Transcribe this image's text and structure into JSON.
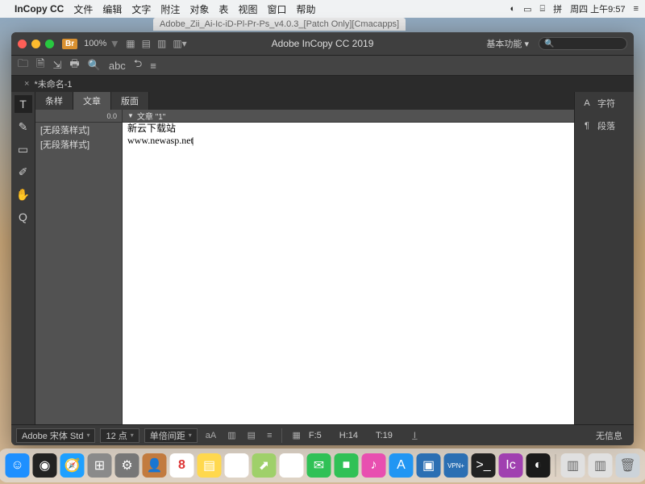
{
  "mac_menubar": {
    "app_name": "InCopy CC",
    "items": [
      "文件",
      "编辑",
      "文字",
      "附注",
      "对象",
      "表",
      "视图",
      "窗口",
      "帮助"
    ],
    "right": {
      "ime": "拼",
      "datetime": "周四 上午9:57"
    }
  },
  "bg_window_title": "Adobe_Zii_Ai-Ic-iD-Pl-Pr-Ps_v4.0.3_[Patch Only][Cmacapps]",
  "titlebar": {
    "badge": "Br",
    "zoom": "100%",
    "title": "Adobe InCopy CC 2019",
    "workspace": "基本功能",
    "search_placeholder": ""
  },
  "doc_tab": {
    "name": "*未命名-1"
  },
  "left_tools": [
    {
      "name": "type-tool",
      "glyph": "T",
      "active": true
    },
    {
      "name": "note-tool",
      "glyph": "✎"
    },
    {
      "name": "frame-tool",
      "glyph": "▭"
    },
    {
      "name": "eyedropper-tool",
      "glyph": "✐"
    },
    {
      "name": "hand-tool",
      "glyph": "✋"
    },
    {
      "name": "zoom-tool",
      "glyph": "Q"
    }
  ],
  "view_tabs": [
    {
      "label": "条样",
      "active": false
    },
    {
      "label": "文章",
      "active": true
    },
    {
      "label": "版面",
      "active": false
    }
  ],
  "style_column": {
    "header": "0.0",
    "rows": [
      "[无段落样式]",
      "[无段落样式]"
    ]
  },
  "story": {
    "title": "文章 \"1\"",
    "lines": [
      "新云下载站",
      "www.newasp.net"
    ]
  },
  "right_panel": [
    {
      "icon": "A",
      "label": "字符",
      "name": "character-panel"
    },
    {
      "icon": "¶",
      "label": "段落",
      "name": "paragraph-panel"
    }
  ],
  "statusbar": {
    "font": "Adobe 宋体 Std",
    "size": "12 点",
    "leading": "单倍间距",
    "metrics": {
      "f": "F:5",
      "h": "H:14",
      "t": "T:19"
    },
    "right_text": "无信息"
  },
  "dock": [
    {
      "name": "finder",
      "bg": "#1e90ff",
      "glyph": "☺"
    },
    {
      "name": "siri",
      "bg": "#222",
      "glyph": "◉"
    },
    {
      "name": "safari",
      "bg": "#1ea0ff",
      "glyph": "🧭"
    },
    {
      "name": "launchpad",
      "bg": "#8a8a8a",
      "glyph": "⊞"
    },
    {
      "name": "preferences",
      "bg": "#777",
      "glyph": "⚙"
    },
    {
      "name": "contacts",
      "bg": "#c27b3f",
      "glyph": "👤"
    },
    {
      "name": "calendar",
      "bg": "#fff",
      "glyph": "8"
    },
    {
      "name": "notepad",
      "bg": "#ffd84d",
      "glyph": "▤"
    },
    {
      "name": "notes",
      "bg": "#fff",
      "glyph": "✎"
    },
    {
      "name": "maps",
      "bg": "#9fd06a",
      "glyph": "⬈"
    },
    {
      "name": "photos",
      "bg": "#fff",
      "glyph": "✿"
    },
    {
      "name": "messages",
      "bg": "#30c156",
      "glyph": "✉"
    },
    {
      "name": "facetime",
      "bg": "#30c156",
      "glyph": "■"
    },
    {
      "name": "itunes",
      "bg": "#e84fb0",
      "glyph": "♪"
    },
    {
      "name": "appstore",
      "bg": "#2196f3",
      "glyph": "A"
    },
    {
      "name": "preview",
      "bg": "#2b6fb3",
      "glyph": "▣"
    },
    {
      "name": "vpn",
      "bg": "#2b6fb3",
      "glyph": "VPN+"
    },
    {
      "name": "terminal",
      "bg": "#222",
      "glyph": ">_"
    },
    {
      "name": "incopy",
      "bg": "#a040b0",
      "glyph": "Ic"
    },
    {
      "name": "creative-cloud",
      "bg": "#1a1a1a",
      "glyph": "◐"
    }
  ]
}
